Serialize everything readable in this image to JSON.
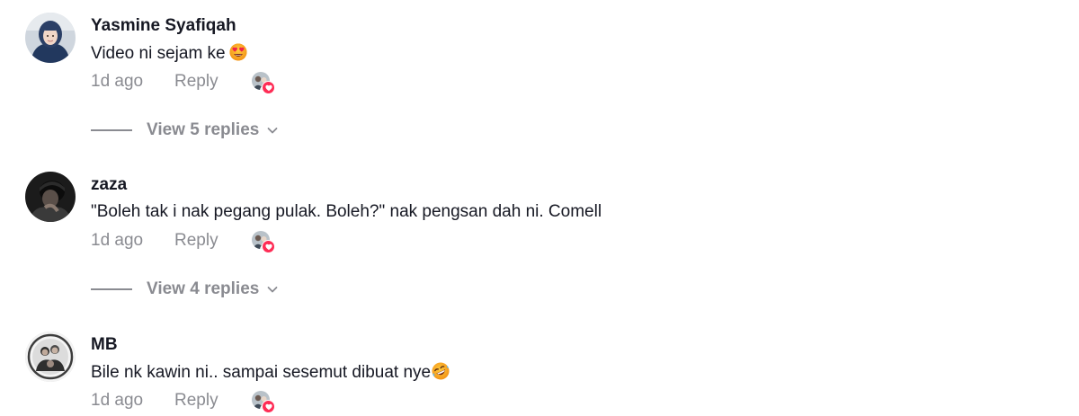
{
  "comments": [
    {
      "username": "Yasmine Syafiqah",
      "text": "Video ni sejam ke",
      "emoji": "heart-eyes-emoji",
      "time": "1d ago",
      "reply_label": "Reply",
      "view_replies": "View 5 replies"
    },
    {
      "username": "zaza",
      "text": "\"Boleh tak i nak pegang pulak. Boleh?\" nak pengsan dah ni. Comell",
      "time": "1d ago",
      "reply_label": "Reply",
      "view_replies": "View 4 replies"
    },
    {
      "username": "MB",
      "text": "Bile nk kawin ni.. sampai sesemut dibuat nye",
      "emoji": "rofl-emoji",
      "time": "1d ago",
      "reply_label": "Reply"
    }
  ],
  "icons": {
    "liked_by_creator": "creator-liked-icon",
    "chevron": "chevron-down-icon"
  },
  "colors": {
    "text": "#161823",
    "muted": "#8a8b91",
    "heart": "#fe2c55"
  }
}
